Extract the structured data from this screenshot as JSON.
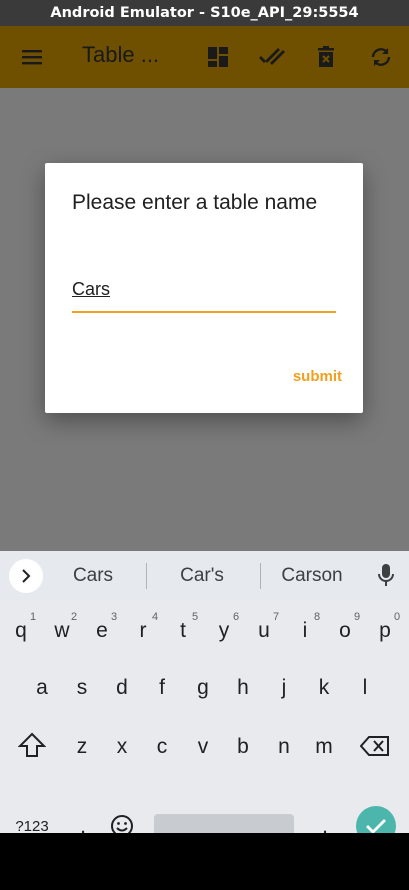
{
  "window": {
    "title": "Android Emulator - S10e_API_29:5554"
  },
  "appbar": {
    "title": "Table ...",
    "icons": [
      "menu-icon",
      "dashboard-icon",
      "done-all-icon",
      "delete-icon",
      "sync-icon"
    ],
    "background": "#6f5000"
  },
  "dialog": {
    "title": "Please enter a table name",
    "input_value": "Cars",
    "submit_label": "submit",
    "accent": "#f0a020"
  },
  "keyboard": {
    "suggestions": [
      "Cars",
      "Car's",
      "Carson"
    ],
    "row1": [
      {
        "key": "q",
        "hint": "1"
      },
      {
        "key": "w",
        "hint": "2"
      },
      {
        "key": "e",
        "hint": "3"
      },
      {
        "key": "r",
        "hint": "4"
      },
      {
        "key": "t",
        "hint": "5"
      },
      {
        "key": "y",
        "hint": "6"
      },
      {
        "key": "u",
        "hint": "7"
      },
      {
        "key": "i",
        "hint": "8"
      },
      {
        "key": "o",
        "hint": "9"
      },
      {
        "key": "p",
        "hint": "0"
      }
    ],
    "row2": [
      "a",
      "s",
      "d",
      "f",
      "g",
      "h",
      "j",
      "k",
      "l"
    ],
    "row3": [
      "z",
      "x",
      "c",
      "v",
      "b",
      "n",
      "m"
    ],
    "symbols_label": "?123",
    "comma": ",",
    "period": ".",
    "enter_color": "#4db6ac"
  }
}
